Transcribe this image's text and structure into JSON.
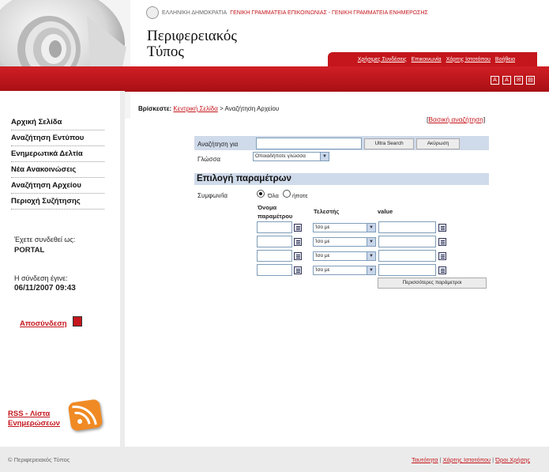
{
  "header": {
    "gov_name": "ΕΛΛΗΝΙΚΗ ΔΗΜΟΚΡΑΤΙΑ",
    "gov_secretariats": "ΓΕΝΙΚΗ ΓΡΑΜΜΑΤΕΙΑ ΕΠΙΚΟΙΝΩΝΙΑΣ - ΓΕΝΙΚΗ ΓΡΑΜΜΑΤΕΙΑ ΕΝΗΜΕΡΩΣΗΣ",
    "site_title_line1": "Περιφερειακός",
    "site_title_line2": "Τύπος",
    "topnav": [
      "Χρήσιμες Συνδέσεις",
      "Επικοινωνία",
      "Χάρτης Ιστοτόπου",
      "Βοήθεια"
    ]
  },
  "sidebar": {
    "items": [
      {
        "label": "Αρχική Σελίδα"
      },
      {
        "label": "Αναζήτηση Εντύπου"
      },
      {
        "label": "Ενημερωτικά Δελτία"
      },
      {
        "label": "Νέα Ανακοινώσεις"
      },
      {
        "label": "Αναζήτηση Αρχείου"
      },
      {
        "label": "Περιοχή Συζήτησης"
      }
    ],
    "login_label": "Έχετε συνδεθεί ως:",
    "login_user": "PORTAL",
    "connection_label": "Η σύνδεση έγινε:",
    "connection_time": "06/11/2007 09:43",
    "logout_label": "Αποσύνδεση",
    "rss_label": "RSS - Λίστα Ενημερώσεων"
  },
  "main": {
    "breadcrumb_prefix": "Βρίσκεστε:",
    "breadcrumb_home": "Κεντρική Σελίδα",
    "breadcrumb_current": "> Αναζήτηση Αρχείου",
    "basic_search_link": "Βασική αναζήτηση",
    "search_label": "Αναζήτηση για",
    "search_value": "",
    "ultra_search_button": "Ultra Search",
    "cancel_button": "Ακύρωση",
    "language_label": "Γλώσσα",
    "language_selected": "Οποιαδήποτε γλώσσα",
    "params_heading": "Επιλογή παραμέτρων",
    "agreement_label": "Συμφων/ία",
    "radio_all": "Όλα",
    "radio_any": "ήποτε",
    "col_name": "Όνομα παραμέτρου",
    "col_operator": "Τελεστής",
    "col_value": "value",
    "rows": [
      {
        "operator": "Ίσο με"
      },
      {
        "operator": "Ίσο με"
      },
      {
        "operator": "Ίσο με"
      },
      {
        "operator": "Ίσο με"
      }
    ],
    "more_params_button": "Περισσότερες παράμετροι"
  },
  "footer": {
    "copyright": "© Περιφερειακός Τύπος",
    "links": [
      "Ταυτότητα",
      "Χάρτης Ιστοτόπου",
      "Όροι Χρήσης"
    ]
  },
  "colors": {
    "brand_red": "#c4161c",
    "band_blue": "#cfdaea",
    "rss_orange": "#f08a24"
  }
}
